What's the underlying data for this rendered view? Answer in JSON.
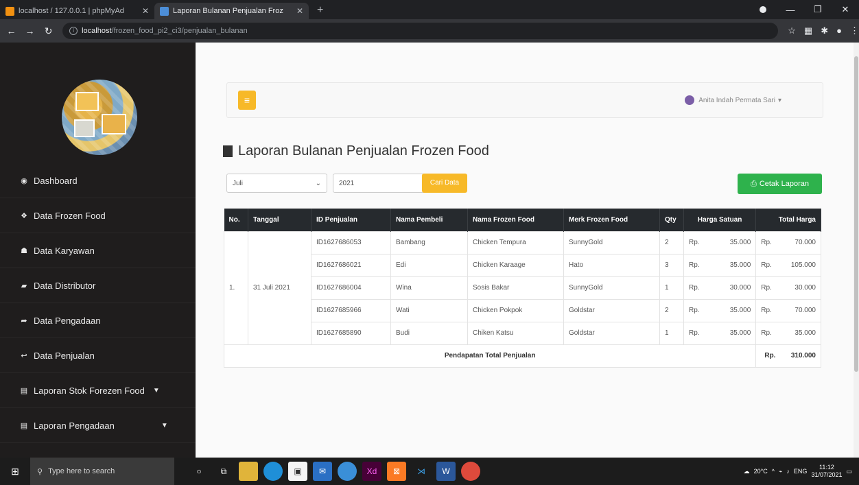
{
  "browser": {
    "tabs": [
      {
        "label": "localhost / 127.0.0.1 | phpMyAd",
        "active": false
      },
      {
        "label": "Laporan Bulanan Penjualan Froz",
        "active": true
      }
    ],
    "url_host": "localhost",
    "url_path": "/frozen_food_pi2_ci3/penjualan_bulanan"
  },
  "sidebar": {
    "items": [
      {
        "label": "Dashboard",
        "icon": "dashboard-icon"
      },
      {
        "label": "Data Frozen Food",
        "icon": "cubes-icon"
      },
      {
        "label": "Data Karyawan",
        "icon": "users-icon"
      },
      {
        "label": "Data Distributor",
        "icon": "truck-icon"
      },
      {
        "label": "Data Pengadaan",
        "icon": "share-icon"
      },
      {
        "label": "Data Penjualan",
        "icon": "reply-icon"
      },
      {
        "label": "Laporan Stok Forezen Food",
        "icon": "file-icon",
        "caret": true
      },
      {
        "label": "Laporan Pengadaan",
        "icon": "file-icon",
        "caret": true
      }
    ]
  },
  "topnav": {
    "user_name": "Anita Indah Permata Sari"
  },
  "page": {
    "title": "Laporan Bulanan Penjualan Frozen Food",
    "month": "Juli",
    "year": "2021",
    "search_button": "Cari Data",
    "print_button": "Cetak Laporan"
  },
  "table": {
    "headers": [
      "No.",
      "Tanggal",
      "ID Penjualan",
      "Nama Pembeli",
      "Nama Frozen Food",
      "Merk Frozen Food",
      "Qty",
      "Harga Satuan",
      "Total Harga"
    ],
    "group_no": "1.",
    "group_date": "31 Juli 2021",
    "currency": "Rp.",
    "rows": [
      {
        "id": "ID1627686053",
        "buyer": "Bambang",
        "food": "Chicken Tempura",
        "brand": "SunnyGold",
        "qty": "2",
        "price": "35.000",
        "total": "70.000"
      },
      {
        "id": "ID1627686021",
        "buyer": "Edi",
        "food": "Chicken Karaage",
        "brand": "Hato",
        "qty": "3",
        "price": "35.000",
        "total": "105.000"
      },
      {
        "id": "ID1627686004",
        "buyer": "Wina",
        "food": "Sosis Bakar",
        "brand": "SunnyGold",
        "qty": "1",
        "price": "30.000",
        "total": "30.000"
      },
      {
        "id": "ID1627685966",
        "buyer": "Wati",
        "food": "Chicken Pokpok",
        "brand": "Goldstar",
        "qty": "2",
        "price": "35.000",
        "total": "70.000"
      },
      {
        "id": "ID1627685890",
        "buyer": "Budi",
        "food": "Chiken Katsu",
        "brand": "Goldstar",
        "qty": "1",
        "price": "35.000",
        "total": "35.000"
      }
    ],
    "total_label": "Pendapatan Total Penjualan",
    "total_value": "310.000"
  },
  "taskbar": {
    "search_placeholder": "Type here to search",
    "weather": "20°C",
    "lang": "ENG",
    "time": "11:12",
    "date": "31/07/2021"
  },
  "colors": {
    "sidebar_bg": "#1f1d1d",
    "accent_yellow": "#f7b928",
    "accent_green": "#2eb24c",
    "table_header": "#262a2e"
  }
}
